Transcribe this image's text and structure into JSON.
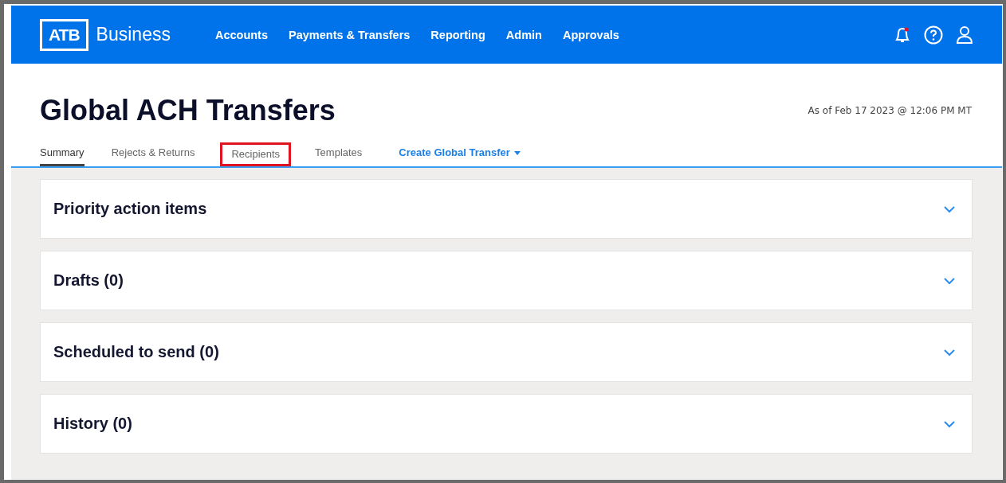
{
  "header": {
    "logo_mark": "ATB",
    "logo_text": "Business",
    "nav": [
      {
        "label": "Accounts",
        "selected": false
      },
      {
        "label": "Payments & Transfers",
        "selected": false
      },
      {
        "label": "Reporting",
        "selected": false
      },
      {
        "label": "Admin",
        "selected": false
      },
      {
        "label": "Approvals",
        "selected": false
      }
    ],
    "notifications_unread": true
  },
  "page": {
    "title": "Global ACH Transfers",
    "timestamp": "As of Feb 17 2023 @ 12:06 PM MT"
  },
  "tabs": [
    {
      "label": "Summary",
      "selected": true,
      "highlighted": false,
      "kind": "tab"
    },
    {
      "label": "Rejects & Returns",
      "selected": false,
      "highlighted": false,
      "kind": "tab"
    },
    {
      "label": "Recipients",
      "selected": false,
      "highlighted": true,
      "kind": "tab"
    },
    {
      "label": "Templates",
      "selected": false,
      "highlighted": false,
      "kind": "tab"
    },
    {
      "label": "Create Global Transfer",
      "selected": false,
      "highlighted": false,
      "kind": "menu"
    }
  ],
  "sections": [
    {
      "title": "Priority action items",
      "expanded": false
    },
    {
      "title": "Drafts (0)",
      "expanded": false
    },
    {
      "title": "Scheduled to send (0)",
      "expanded": false
    },
    {
      "title": "History (0)",
      "expanded": false
    }
  ]
}
